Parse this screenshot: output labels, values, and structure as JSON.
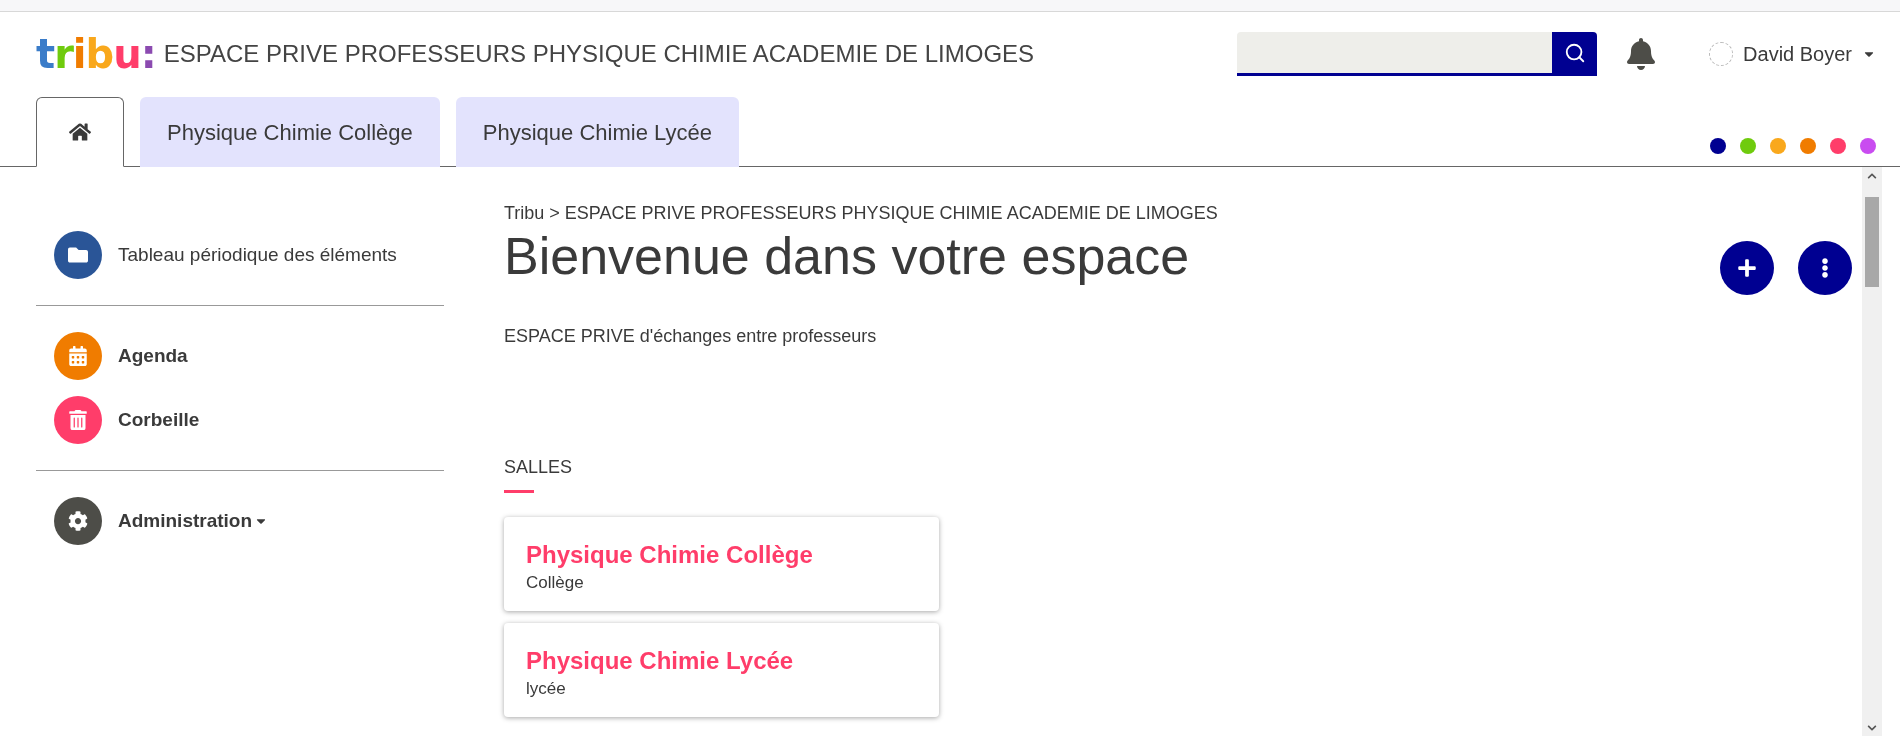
{
  "header": {
    "logo": "tribu:",
    "site_title": "ESPACE PRIVE PROFESSEURS PHYSIQUE CHIMIE ACADEMIE DE LIMOGES",
    "user": "David Boyer"
  },
  "tabs": [
    {
      "kind": "home",
      "selected": true
    },
    {
      "kind": "text",
      "label": "Physique Chimie Collège",
      "selected": false
    },
    {
      "kind": "text",
      "label": "Physique Chimie Lycée",
      "selected": false
    }
  ],
  "theme_dots": [
    {
      "color": "#000091"
    },
    {
      "color": "#6fcb0d"
    },
    {
      "color": "#f9a81c"
    },
    {
      "color": "#f07c00"
    },
    {
      "color": "#ff3d6a"
    },
    {
      "color": "#c94cf0"
    }
  ],
  "sidebar": {
    "groups": [
      [
        {
          "kind": "folder",
          "label": "Tableau périodique des éléments",
          "bold": false,
          "dropdown": false
        }
      ],
      [
        {
          "kind": "calendar",
          "label": "Agenda",
          "bold": true,
          "dropdown": false
        },
        {
          "kind": "trash",
          "label": "Corbeille",
          "bold": true,
          "dropdown": false
        }
      ],
      [
        {
          "kind": "gear",
          "label": "Administration",
          "bold": true,
          "dropdown": true
        }
      ]
    ]
  },
  "main": {
    "breadcrumb": [
      "Tribu",
      "ESPACE PRIVE PROFESSEURS PHYSIQUE CHIMIE ACADEMIE DE LIMOGES"
    ],
    "breadcrumb_separator": ">",
    "title": "Bienvenue dans votre espace",
    "description": "ESPACE PRIVE d'échanges entre professeurs",
    "section_title": "SALLES",
    "rooms": [
      {
        "name": "Physique Chimie Collège",
        "subtitle": "Collège"
      },
      {
        "name": "Physique Chimie Lycée",
        "subtitle": "lycée"
      }
    ]
  }
}
